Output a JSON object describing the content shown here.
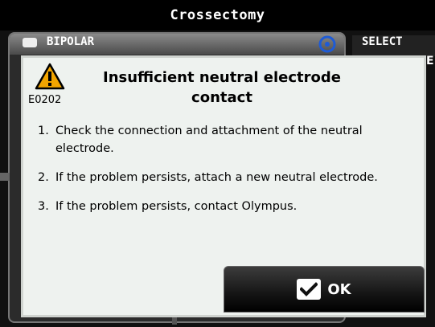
{
  "window": {
    "title": "Crossectomy"
  },
  "background": {
    "mode_label": "BIPOLAR",
    "select_label": "SELECT",
    "right_letter": "E"
  },
  "dialog": {
    "icon": "warning-triangle-icon",
    "error_code": "E0202",
    "title_line1": "Insufficient neutral electrode",
    "title_line2": "contact",
    "steps": [
      {
        "num": "1.",
        "text": "Check the connection and attachment of the neutral electrode."
      },
      {
        "num": "2.",
        "text": "If the problem persists, attach a new neutral electrode."
      },
      {
        "num": "3.",
        "text": "If the problem persists, contact Olympus."
      }
    ],
    "ok_label": "OK",
    "ok_icon": "checkmark-icon"
  },
  "colors": {
    "warning_fill": "#f2a500",
    "dialog_bg": "#eef2ef",
    "accent_blue": "#1e5bd6"
  }
}
